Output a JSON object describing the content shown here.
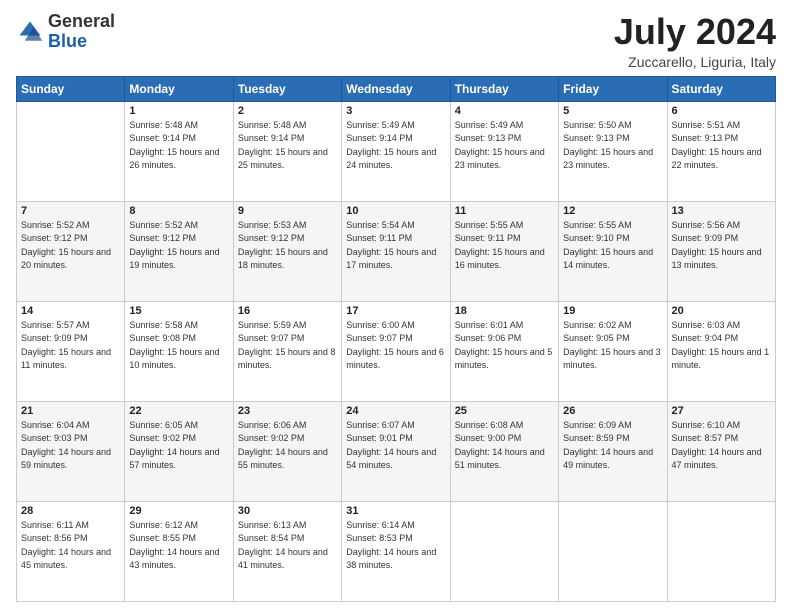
{
  "logo": {
    "general": "General",
    "blue": "Blue"
  },
  "header": {
    "month_year": "July 2024",
    "location": "Zuccarello, Liguria, Italy"
  },
  "weekdays": [
    "Sunday",
    "Monday",
    "Tuesday",
    "Wednesday",
    "Thursday",
    "Friday",
    "Saturday"
  ],
  "weeks": [
    [
      {
        "day": "",
        "sunrise": "",
        "sunset": "",
        "daylight": ""
      },
      {
        "day": "1",
        "sunrise": "Sunrise: 5:48 AM",
        "sunset": "Sunset: 9:14 PM",
        "daylight": "Daylight: 15 hours and 26 minutes."
      },
      {
        "day": "2",
        "sunrise": "Sunrise: 5:48 AM",
        "sunset": "Sunset: 9:14 PM",
        "daylight": "Daylight: 15 hours and 25 minutes."
      },
      {
        "day": "3",
        "sunrise": "Sunrise: 5:49 AM",
        "sunset": "Sunset: 9:14 PM",
        "daylight": "Daylight: 15 hours and 24 minutes."
      },
      {
        "day": "4",
        "sunrise": "Sunrise: 5:49 AM",
        "sunset": "Sunset: 9:13 PM",
        "daylight": "Daylight: 15 hours and 23 minutes."
      },
      {
        "day": "5",
        "sunrise": "Sunrise: 5:50 AM",
        "sunset": "Sunset: 9:13 PM",
        "daylight": "Daylight: 15 hours and 23 minutes."
      },
      {
        "day": "6",
        "sunrise": "Sunrise: 5:51 AM",
        "sunset": "Sunset: 9:13 PM",
        "daylight": "Daylight: 15 hours and 22 minutes."
      }
    ],
    [
      {
        "day": "7",
        "sunrise": "Sunrise: 5:52 AM",
        "sunset": "Sunset: 9:12 PM",
        "daylight": "Daylight: 15 hours and 20 minutes."
      },
      {
        "day": "8",
        "sunrise": "Sunrise: 5:52 AM",
        "sunset": "Sunset: 9:12 PM",
        "daylight": "Daylight: 15 hours and 19 minutes."
      },
      {
        "day": "9",
        "sunrise": "Sunrise: 5:53 AM",
        "sunset": "Sunset: 9:12 PM",
        "daylight": "Daylight: 15 hours and 18 minutes."
      },
      {
        "day": "10",
        "sunrise": "Sunrise: 5:54 AM",
        "sunset": "Sunset: 9:11 PM",
        "daylight": "Daylight: 15 hours and 17 minutes."
      },
      {
        "day": "11",
        "sunrise": "Sunrise: 5:55 AM",
        "sunset": "Sunset: 9:11 PM",
        "daylight": "Daylight: 15 hours and 16 minutes."
      },
      {
        "day": "12",
        "sunrise": "Sunrise: 5:55 AM",
        "sunset": "Sunset: 9:10 PM",
        "daylight": "Daylight: 15 hours and 14 minutes."
      },
      {
        "day": "13",
        "sunrise": "Sunrise: 5:56 AM",
        "sunset": "Sunset: 9:09 PM",
        "daylight": "Daylight: 15 hours and 13 minutes."
      }
    ],
    [
      {
        "day": "14",
        "sunrise": "Sunrise: 5:57 AM",
        "sunset": "Sunset: 9:09 PM",
        "daylight": "Daylight: 15 hours and 11 minutes."
      },
      {
        "day": "15",
        "sunrise": "Sunrise: 5:58 AM",
        "sunset": "Sunset: 9:08 PM",
        "daylight": "Daylight: 15 hours and 10 minutes."
      },
      {
        "day": "16",
        "sunrise": "Sunrise: 5:59 AM",
        "sunset": "Sunset: 9:07 PM",
        "daylight": "Daylight: 15 hours and 8 minutes."
      },
      {
        "day": "17",
        "sunrise": "Sunrise: 6:00 AM",
        "sunset": "Sunset: 9:07 PM",
        "daylight": "Daylight: 15 hours and 6 minutes."
      },
      {
        "day": "18",
        "sunrise": "Sunrise: 6:01 AM",
        "sunset": "Sunset: 9:06 PM",
        "daylight": "Daylight: 15 hours and 5 minutes."
      },
      {
        "day": "19",
        "sunrise": "Sunrise: 6:02 AM",
        "sunset": "Sunset: 9:05 PM",
        "daylight": "Daylight: 15 hours and 3 minutes."
      },
      {
        "day": "20",
        "sunrise": "Sunrise: 6:03 AM",
        "sunset": "Sunset: 9:04 PM",
        "daylight": "Daylight: 15 hours and 1 minute."
      }
    ],
    [
      {
        "day": "21",
        "sunrise": "Sunrise: 6:04 AM",
        "sunset": "Sunset: 9:03 PM",
        "daylight": "Daylight: 14 hours and 59 minutes."
      },
      {
        "day": "22",
        "sunrise": "Sunrise: 6:05 AM",
        "sunset": "Sunset: 9:02 PM",
        "daylight": "Daylight: 14 hours and 57 minutes."
      },
      {
        "day": "23",
        "sunrise": "Sunrise: 6:06 AM",
        "sunset": "Sunset: 9:02 PM",
        "daylight": "Daylight: 14 hours and 55 minutes."
      },
      {
        "day": "24",
        "sunrise": "Sunrise: 6:07 AM",
        "sunset": "Sunset: 9:01 PM",
        "daylight": "Daylight: 14 hours and 54 minutes."
      },
      {
        "day": "25",
        "sunrise": "Sunrise: 6:08 AM",
        "sunset": "Sunset: 9:00 PM",
        "daylight": "Daylight: 14 hours and 51 minutes."
      },
      {
        "day": "26",
        "sunrise": "Sunrise: 6:09 AM",
        "sunset": "Sunset: 8:59 PM",
        "daylight": "Daylight: 14 hours and 49 minutes."
      },
      {
        "day": "27",
        "sunrise": "Sunrise: 6:10 AM",
        "sunset": "Sunset: 8:57 PM",
        "daylight": "Daylight: 14 hours and 47 minutes."
      }
    ],
    [
      {
        "day": "28",
        "sunrise": "Sunrise: 6:11 AM",
        "sunset": "Sunset: 8:56 PM",
        "daylight": "Daylight: 14 hours and 45 minutes."
      },
      {
        "day": "29",
        "sunrise": "Sunrise: 6:12 AM",
        "sunset": "Sunset: 8:55 PM",
        "daylight": "Daylight: 14 hours and 43 minutes."
      },
      {
        "day": "30",
        "sunrise": "Sunrise: 6:13 AM",
        "sunset": "Sunset: 8:54 PM",
        "daylight": "Daylight: 14 hours and 41 minutes."
      },
      {
        "day": "31",
        "sunrise": "Sunrise: 6:14 AM",
        "sunset": "Sunset: 8:53 PM",
        "daylight": "Daylight: 14 hours and 38 minutes."
      },
      {
        "day": "",
        "sunrise": "",
        "sunset": "",
        "daylight": ""
      },
      {
        "day": "",
        "sunrise": "",
        "sunset": "",
        "daylight": ""
      },
      {
        "day": "",
        "sunrise": "",
        "sunset": "",
        "daylight": ""
      }
    ]
  ]
}
